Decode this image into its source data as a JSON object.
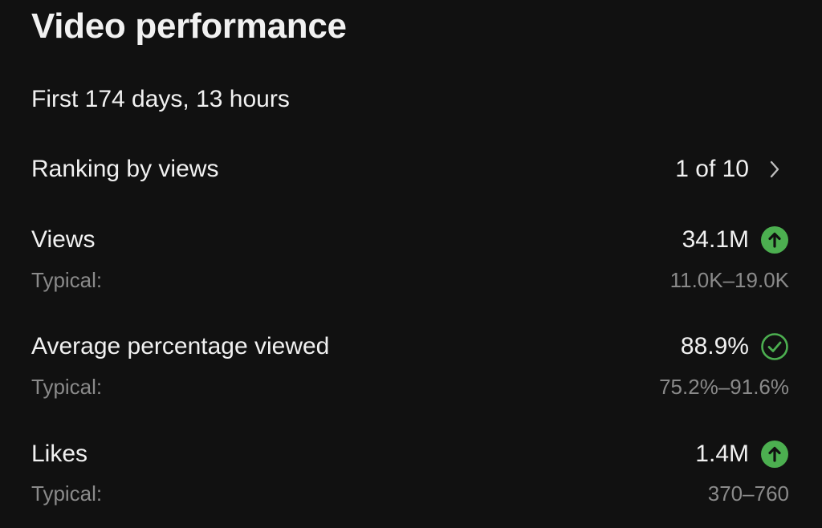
{
  "header": {
    "title": "Video performance"
  },
  "period": "First 174 days, 13 hours",
  "ranking": {
    "label": "Ranking by views",
    "value": "1 of 10",
    "icon": "chevron-right-icon"
  },
  "metrics": [
    {
      "label": "Views",
      "value": "34.1M",
      "status_icon": "arrow-up-circle-icon",
      "typical_label": "Typical:",
      "typical_range": "11.0K–19.0K"
    },
    {
      "label": "Average percentage viewed",
      "value": "88.9%",
      "status_icon": "check-circle-icon",
      "typical_label": "Typical:",
      "typical_range": "75.2%–91.6%"
    },
    {
      "label": "Likes",
      "value": "1.4M",
      "status_icon": "arrow-up-circle-icon",
      "typical_label": "Typical:",
      "typical_range": "370–760"
    }
  ],
  "colors": {
    "background": "#111111",
    "text_primary": "#f1f1f1",
    "text_secondary": "#8a8a8a",
    "positive": "#4caf50"
  }
}
